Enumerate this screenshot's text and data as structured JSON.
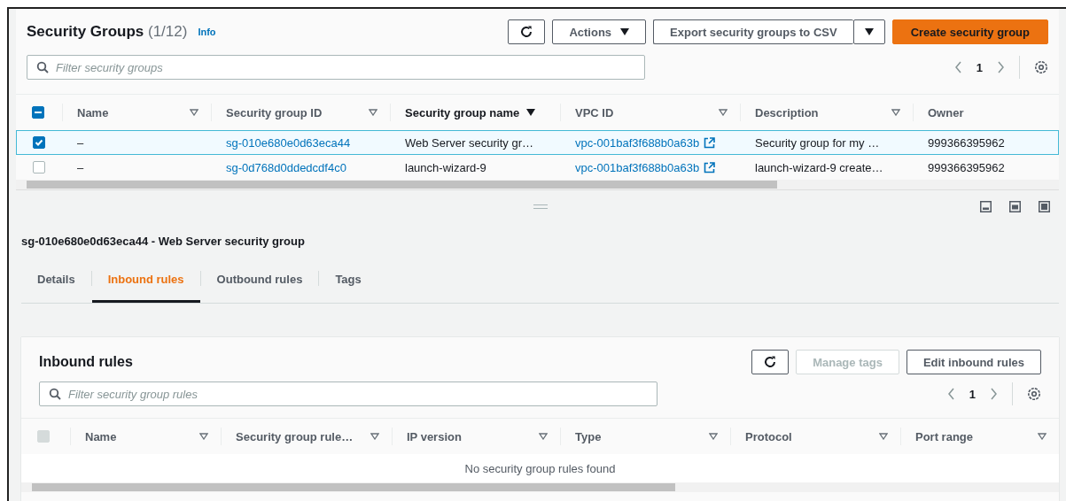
{
  "list": {
    "title": "Security Groups",
    "count": "(1/12)",
    "info": "Info",
    "actions": "Actions",
    "export": "Export security groups to CSV",
    "create": "Create security group",
    "filter": {
      "placeholder": "Filter security groups"
    },
    "page": "1",
    "header_checkbox": {
      "indeterminate": true
    },
    "columns": [
      {
        "label": "Name",
        "sorted": false
      },
      {
        "label": "Security group ID",
        "sorted": false
      },
      {
        "label": "Security group name",
        "sorted": true
      },
      {
        "label": "VPC ID",
        "sorted": false
      },
      {
        "label": "Description",
        "sorted": false
      },
      {
        "label": "Owner",
        "sorted": false
      }
    ],
    "rows": [
      {
        "selected": true,
        "name": "–",
        "group_id": "sg-010e680e0d63eca44",
        "group_name": "Web Server security gr…",
        "vpc_id": "vpc-001baf3f688b0a63b",
        "description": "Security group for my …",
        "owner": "999366395962"
      },
      {
        "selected": false,
        "name": "–",
        "group_id": "sg-0d768d0ddedcdf4c0",
        "group_name": "launch-wizard-9",
        "vpc_id": "vpc-001baf3f688b0a63b",
        "description": "launch-wizard-9 create…",
        "owner": "999366395962"
      }
    ]
  },
  "details": {
    "title": "sg-010e680e0d63eca44 - Web Server security group",
    "tabs": [
      {
        "label": "Details",
        "selected": false
      },
      {
        "label": "Inbound rules",
        "selected": true
      },
      {
        "label": "Outbound rules",
        "selected": false
      },
      {
        "label": "Tags",
        "selected": false
      }
    ]
  },
  "inbound": {
    "title": "Inbound rules",
    "buttons": [
      {
        "label": "Manage tags",
        "disabled": true
      },
      {
        "label": "Edit inbound rules",
        "disabled": false
      }
    ],
    "filter": {
      "placeholder": "Filter security group rules"
    },
    "page": "1",
    "header_checkbox": {
      "disabled": true
    },
    "columns": [
      "Name",
      "Security group rule…",
      "IP version",
      "Type",
      "Protocol",
      "Port range"
    ],
    "empty": "No security group rules found"
  }
}
